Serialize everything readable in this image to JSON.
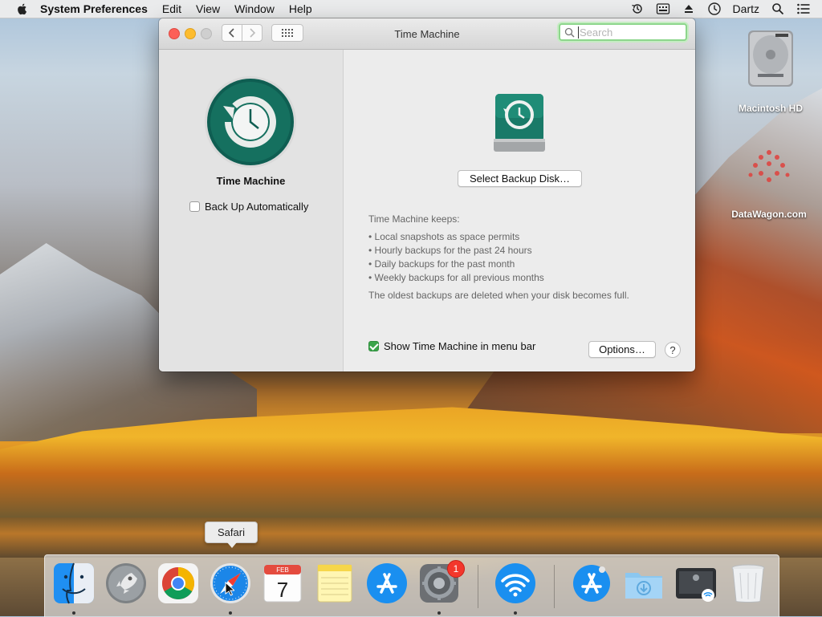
{
  "menubar": {
    "app_name": "System Preferences",
    "menus": [
      "Edit",
      "View",
      "Window",
      "Help"
    ],
    "user": "Dartz"
  },
  "desktop": {
    "icons": [
      {
        "label": "Macintosh HD",
        "icon": "hard-drive-icon"
      },
      {
        "label": "DataWagon.com",
        "icon": "datawagon-logo-icon"
      }
    ]
  },
  "window": {
    "title": "Time Machine",
    "search_placeholder": "Search",
    "sidebar": {
      "app_label": "Time Machine",
      "auto_backup_label": "Back Up Automatically",
      "auto_backup_checked": false
    },
    "main": {
      "select_disk_label": "Select Backup Disk…",
      "keeps_heading": "Time Machine keeps:",
      "keeps_items": [
        "Local snapshots as space permits",
        "Hourly backups for the past 24 hours",
        "Daily backups for the past month",
        "Weekly backups for all previous months"
      ],
      "oldest_note": "The oldest backups are deleted when your disk becomes full.",
      "show_menubar_label": "Show Time Machine in menu bar",
      "show_menubar_checked": true,
      "options_label": "Options…",
      "help_label": "?"
    }
  },
  "dock": {
    "tooltip": "Safari",
    "calendar": {
      "month": "FEB",
      "day": "7"
    },
    "sysprefs_badge": "1"
  },
  "colors": {
    "tm_green": "#11685b",
    "check_green": "#3aa44a",
    "search_focus": "#8dd68c"
  }
}
